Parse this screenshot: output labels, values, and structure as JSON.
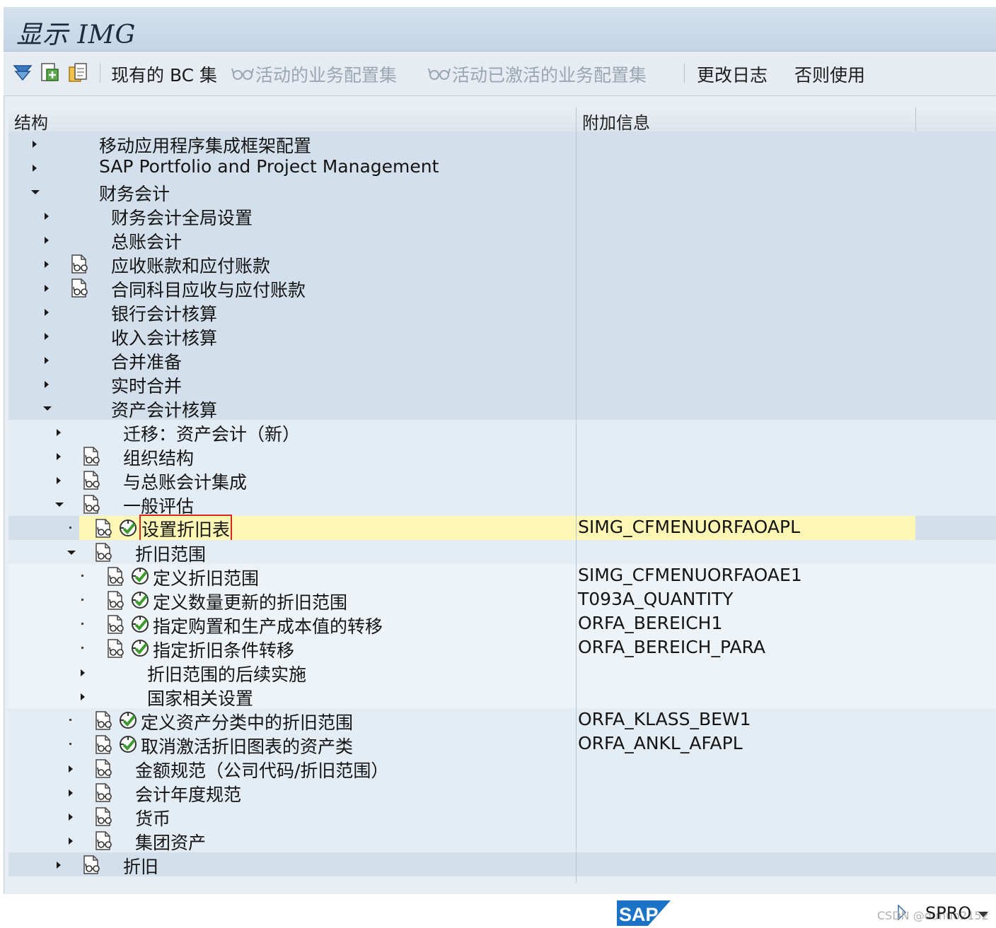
{
  "window": {
    "title": "显示 IMG"
  },
  "toolbar": {
    "buttons": [
      {
        "label": "现有的 BC 集",
        "enabled": true
      },
      {
        "label": "活动的业务配置集",
        "enabled": false
      },
      {
        "label": "活动已激活的业务配置集",
        "enabled": false
      },
      {
        "label": "更改日志",
        "enabled": true
      },
      {
        "label": "否则使用",
        "enabled": true
      }
    ],
    "icons": [
      "filter-icon",
      "transport-icon",
      "clipboard-icon"
    ]
  },
  "tree": {
    "columns": [
      "结构",
      "附加信息"
    ],
    "rows": [
      {
        "label": "移动应用程序集成框架配置",
        "info": "",
        "level": 0,
        "state": "collapsed",
        "doc": false,
        "exec": false
      },
      {
        "label": "SAP Portfolio and Project Management",
        "info": "",
        "level": 0,
        "state": "collapsed",
        "doc": false,
        "exec": false
      },
      {
        "label": "财务会计",
        "info": "",
        "level": 0,
        "state": "expanded",
        "doc": false,
        "exec": false
      },
      {
        "label": "财务会计全局设置",
        "info": "",
        "level": 1,
        "state": "collapsed",
        "doc": false,
        "exec": false
      },
      {
        "label": "总账会计",
        "info": "",
        "level": 1,
        "state": "collapsed",
        "doc": false,
        "exec": false
      },
      {
        "label": "应收账款和应付账款",
        "info": "",
        "level": 1,
        "state": "collapsed",
        "doc": true,
        "exec": false
      },
      {
        "label": "合同科目应收与应付账款",
        "info": "",
        "level": 1,
        "state": "collapsed",
        "doc": true,
        "exec": false
      },
      {
        "label": "银行会计核算",
        "info": "",
        "level": 1,
        "state": "collapsed",
        "doc": false,
        "exec": false
      },
      {
        "label": "收入会计核算",
        "info": "",
        "level": 1,
        "state": "collapsed",
        "doc": false,
        "exec": false
      },
      {
        "label": "合并准备",
        "info": "",
        "level": 1,
        "state": "collapsed",
        "doc": false,
        "exec": false
      },
      {
        "label": "实时合并",
        "info": "",
        "level": 1,
        "state": "collapsed",
        "doc": false,
        "exec": false
      },
      {
        "label": "资产会计核算",
        "info": "",
        "level": 1,
        "state": "expanded",
        "doc": false,
        "exec": false
      },
      {
        "label": "迁移：资产会计（新）",
        "info": "",
        "level": 2,
        "state": "collapsed",
        "doc": false,
        "exec": false
      },
      {
        "label": "组织结构",
        "info": "",
        "level": 2,
        "state": "collapsed",
        "doc": true,
        "exec": false
      },
      {
        "label": "与总账会计集成",
        "info": "",
        "level": 2,
        "state": "collapsed",
        "doc": true,
        "exec": false
      },
      {
        "label": "一般评估",
        "info": "",
        "level": 2,
        "state": "expanded",
        "doc": true,
        "exec": false
      },
      {
        "label": "设置折旧表",
        "info": "SIMG_CFMENUORFAOAPL",
        "level": 3,
        "state": "leaf",
        "doc": true,
        "exec": true,
        "selected": true
      },
      {
        "label": "折旧范围",
        "info": "",
        "level": 3,
        "state": "expanded",
        "doc": true,
        "exec": false
      },
      {
        "label": "定义折旧范围",
        "info": "SIMG_CFMENUORFAOAE1",
        "level": 4,
        "state": "leaf",
        "doc": true,
        "exec": true
      },
      {
        "label": "定义数量更新的折旧范围",
        "info": "T093A_QUANTITY",
        "level": 4,
        "state": "leaf",
        "doc": true,
        "exec": true
      },
      {
        "label": "指定购置和生产成本值的转移",
        "info": "ORFA_BEREICH1",
        "level": 4,
        "state": "leaf",
        "doc": true,
        "exec": true
      },
      {
        "label": "指定折旧条件转移",
        "info": "ORFA_BEREICH_PARA",
        "level": 4,
        "state": "leaf",
        "doc": true,
        "exec": true
      },
      {
        "label": "折旧范围的后续实施",
        "info": "",
        "level": 4,
        "state": "collapsed",
        "doc": false,
        "exec": false
      },
      {
        "label": "国家相关设置",
        "info": "",
        "level": 4,
        "state": "collapsed",
        "doc": false,
        "exec": false
      },
      {
        "label": "定义资产分类中的折旧范围",
        "info": "ORFA_KLASS_BEW1",
        "level": 3,
        "state": "leaf",
        "doc": true,
        "exec": true
      },
      {
        "label": "取消激活折旧图表的资产类",
        "info": "ORFA_ANKL_AFAPL",
        "level": 3,
        "state": "leaf",
        "doc": true,
        "exec": true
      },
      {
        "label": "金额规范（公司代码/折旧范围）",
        "info": "",
        "level": 3,
        "state": "collapsed",
        "doc": true,
        "exec": false
      },
      {
        "label": "会计年度规范",
        "info": "",
        "level": 3,
        "state": "collapsed",
        "doc": true,
        "exec": false
      },
      {
        "label": "货币",
        "info": "",
        "level": 3,
        "state": "collapsed",
        "doc": true,
        "exec": false
      },
      {
        "label": "集团资产",
        "info": "",
        "level": 3,
        "state": "collapsed",
        "doc": true,
        "exec": false
      },
      {
        "label": "折旧",
        "info": "",
        "level": 2,
        "state": "collapsed",
        "doc": true,
        "exec": false
      }
    ]
  },
  "status": {
    "transaction": "SPRO",
    "logo": "SAP",
    "watermark": "CSDN @duhuo2152"
  },
  "colors": {
    "band_dark": "#d3e0ec",
    "band_light": "#e4ecf4",
    "band_white": "#eef3f8",
    "selected": "#fdf6b4",
    "accent_red": "#d7261c"
  }
}
